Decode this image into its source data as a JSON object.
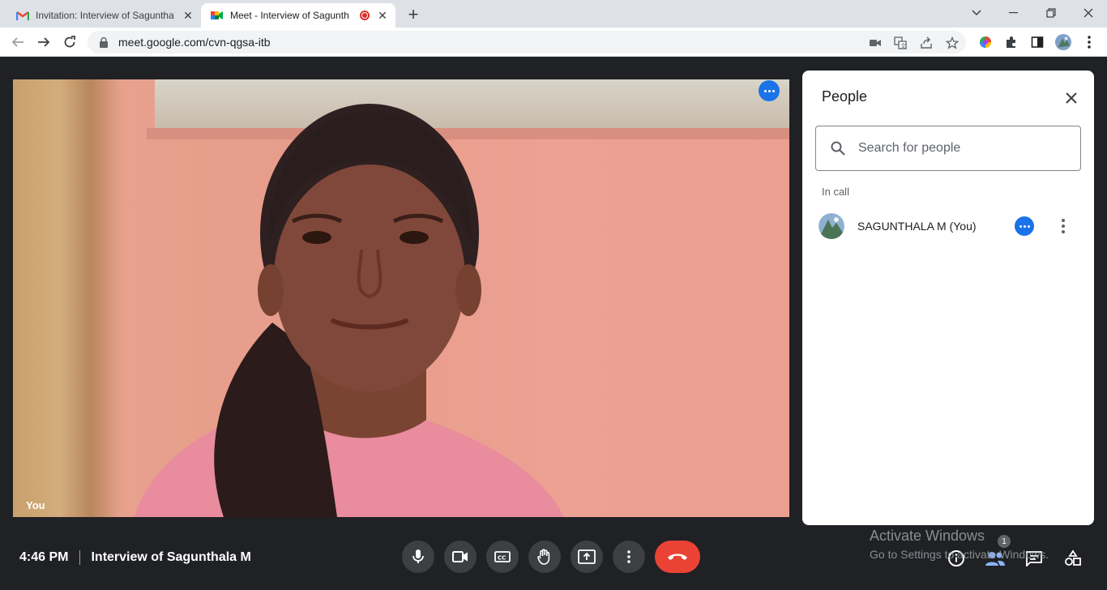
{
  "browser": {
    "tabs": [
      {
        "title": "Invitation: Interview of Saguntha",
        "favicon": "gmail-icon",
        "active": false
      },
      {
        "title": "Meet - Interview of Sagunth",
        "favicon": "meet-icon",
        "active": true,
        "recording": true
      }
    ],
    "new_tab": "+",
    "url": "meet.google.com/cvn-qgsa-itb"
  },
  "video": {
    "self_label": "You"
  },
  "people_panel": {
    "title": "People",
    "search_placeholder": "Search for people",
    "section_label": "In call",
    "participants": [
      {
        "name": "SAGUNTHALA M (You)"
      }
    ]
  },
  "meeting": {
    "time": "4:46 PM",
    "name": "Interview of Sagunthala M"
  },
  "controls": [
    "microphone",
    "camera",
    "captions",
    "raise-hand",
    "present",
    "more-options",
    "leave-call"
  ],
  "right_controls": {
    "people_count": "1"
  },
  "watermark": {
    "line1": "Activate Windows",
    "line2": "Go to Settings to activate Windows."
  },
  "colors": {
    "meet_background": "#202124",
    "accent_blue": "#1a73e8",
    "end_call_red": "#ea4335",
    "control_gray": "#3c4043"
  }
}
